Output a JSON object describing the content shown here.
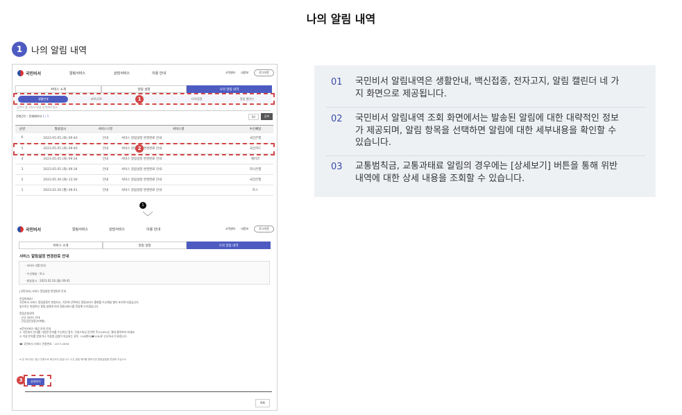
{
  "page_title": "나의 알림 내역",
  "section": {
    "number": "1",
    "label": "나의 알림 내역"
  },
  "shot": {
    "top": {
      "logo": "국민비서",
      "nav": [
        "알림서비스",
        "상담서비스",
        "이용 안내"
      ],
      "util": [
        "고객센터",
        "내정보",
        "로그아웃"
      ],
      "tabs": [
        "서비스 소개",
        "알림 설정",
        "나의 알림 내역"
      ],
      "subtabs": [
        "생활안내",
        "코로나19",
        "",
        "자격/증명",
        "알림 캘린더"
      ],
      "search_placeholder": "검색어 를 서비스명을 입력해주세요",
      "total_prefix": "전체건수 : 전체페이지",
      "total_value": "1 / 1",
      "page_size": "10",
      "search_btn": "검색",
      "table_headers": [
        "순번",
        "발송일시",
        "서비스구분",
        "서비스명",
        "수신채널"
      ],
      "rows": [
        [
          "6",
          "2023.05.05.(화) 09:40",
          "안내",
          "서비스 알림설정 변경완료 안내",
          "국민은행"
        ],
        [
          "5",
          "2023.05.05.(화) 09:40",
          "안내",
          "서비스 알림설정 변경완료 안내",
          "국민카드"
        ],
        [
          "4",
          "2023.05.05.(화) 09:34",
          "안내",
          "서비스 알림설정 변경완료 안내",
          "페이코"
        ],
        [
          "3",
          "2023.05.05.(화) 09:34",
          "안내",
          "서비스 알림설정 변경완료 안내",
          "하나은행"
        ],
        [
          "2",
          "2023.05.30.(화) 13:30",
          "안내",
          "서비스 알림설정 변경완료 안내",
          "국민은행"
        ],
        [
          "1",
          "2023.02.20.(월) 09:41",
          "안내",
          "서비스 알림설정 변경완료 안내",
          "토스"
        ]
      ]
    },
    "bottom": {
      "logo": "국민비서",
      "nav": [
        "알림서비스",
        "상담서비스",
        "이용 안내"
      ],
      "util": [
        "고객센터",
        "내정보",
        "로그아웃"
      ],
      "tabs": [
        "서비스 소개",
        "알림 설정",
        "나의 알림 내역"
      ],
      "detail_title": "서비스 알림설정 변경완료 안내",
      "box_rows": [
        "· 서비스그룹:안내",
        "· 수신채널 : 토스",
        "· 발송일시 : 2023.02.20.(월) 09:41"
      ],
      "body": "[국민비서] 서비스 알림설정 변경완료 안내\n\n안녕하세요?\n국민비서 서비스 알림설정이 변경되고, 기존에 선택하신 알림서비스 홈화를 수신채널 별이 초기화 되었습니다.\n앞으로는 변경하신 알림 설정에 따라 알림서비스를 전달해 드리겠습니다.\n\n알림신청내역\n- 신규 서비스 안내\n- 건강검진일정(조회형)\n\n※문자서비스 제공 부처 안내\n① 국민비서 안내를 가장한 문자를 수신하신 경우, 악성스미싱 안이면 주소(URL)는 절대 클릭하지 마세요\n② 악성 문자를 받았거나 악성앱 감염이 의심되는 경우, 118센터(☎118)로 신고하시기 바랍니다.\n\n☎ 국민비서 서비스 전용번호 : 1577-2559",
      "note": "※ 본 메시지는 발신 전용으로 회신되지 않습니다. 수신 알림 해지를 원하시면 알림설정을 변경해 주십시오.",
      "detail_btn": "상세보기",
      "list_btn": "목록"
    },
    "markers": [
      "1",
      "2",
      "3"
    ],
    "step_marker": "1"
  },
  "descriptions": [
    {
      "num": "01",
      "text": "국민비서 알림내역은 생활안내, 백신접종, 전자고지, 알림 캘린더 네 가지 화면으로 제공됩니다."
    },
    {
      "num": "02",
      "text": "국민비서 알림내역 조회 화면에서는 발송된 알림에 대한 대략적인 정보가 제공되며, 알림 항목을 선택하면 알림에 대한 세부내용을 확인할 수 있습니다."
    },
    {
      "num": "03",
      "text": "교통범칙금, 교통과태료 알림의 경우에는 [상세보기] 버튼을 통해 위반 내역에 대한 상세 내용을 조회할 수 있습니다."
    }
  ]
}
